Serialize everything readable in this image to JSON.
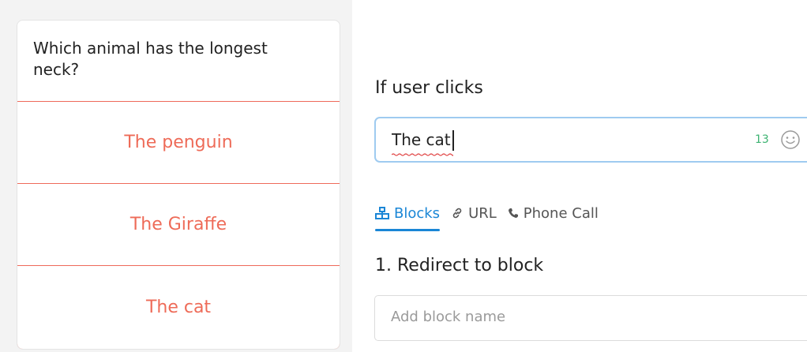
{
  "preview": {
    "question": "Which animal has the longest neck?",
    "options": [
      {
        "label": "The penguin"
      },
      {
        "label": "The Giraffe"
      },
      {
        "label": "The cat"
      }
    ],
    "accent_color": "#ee6b58"
  },
  "editor": {
    "trigger_label": "If user clicks",
    "trigger_value": "The cat",
    "char_count": "13",
    "tabs": [
      {
        "label": "Blocks",
        "icon": "blocks-icon",
        "active": true
      },
      {
        "label": "URL",
        "icon": "link-icon",
        "active": false
      },
      {
        "label": "Phone Call",
        "icon": "phone-icon",
        "active": false
      }
    ],
    "section_title": "1. Redirect to block",
    "block_placeholder": "Add block name",
    "active_color": "#1a86d6"
  }
}
